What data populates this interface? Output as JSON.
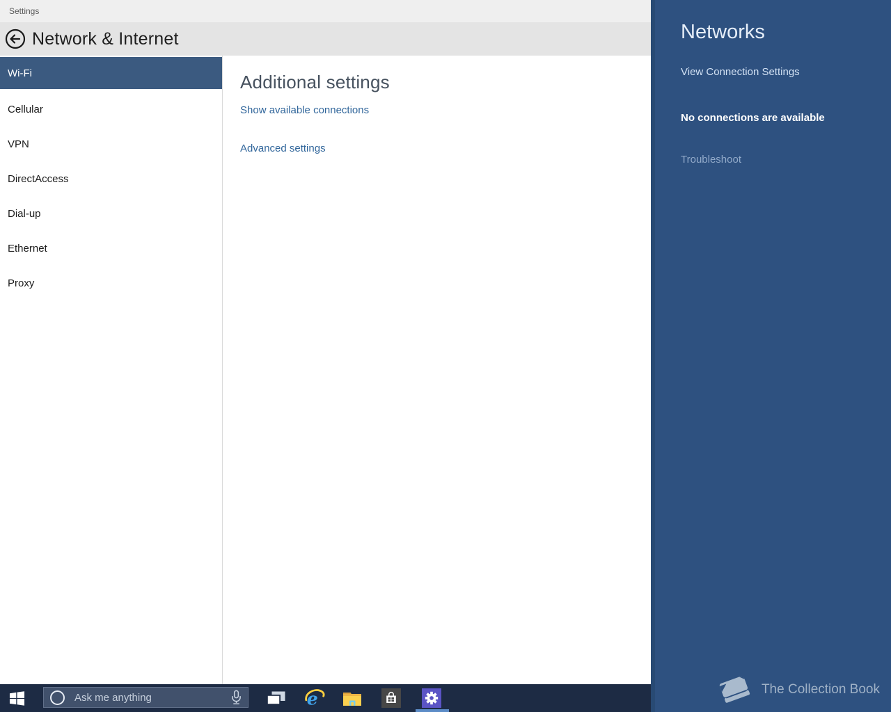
{
  "titlebar": {
    "title": "Settings"
  },
  "header": {
    "title": "Network & Internet",
    "back_icon": "back-arrow-icon"
  },
  "sidebar": {
    "items": [
      {
        "label": "Wi-Fi",
        "selected": true
      },
      {
        "label": "Cellular",
        "selected": false
      },
      {
        "label": "VPN",
        "selected": false
      },
      {
        "label": "DirectAccess",
        "selected": false
      },
      {
        "label": "Dial-up",
        "selected": false
      },
      {
        "label": "Ethernet",
        "selected": false
      },
      {
        "label": "Proxy",
        "selected": false
      }
    ]
  },
  "main": {
    "heading": "Additional settings",
    "links": [
      "Show available connections",
      "Advanced settings"
    ]
  },
  "networks_panel": {
    "title": "Networks",
    "connection_settings_link": "View Connection Settings",
    "status": "No connections are available",
    "troubleshoot": "Troubleshoot",
    "watermark": "The Collection Book",
    "watermark_icon": "book-icon"
  },
  "taskbar": {
    "search_placeholder": "Ask me anything",
    "icons": [
      "start-icon",
      "cortana-circle-icon",
      "microphone-icon",
      "task-view-icon",
      "internet-explorer-icon",
      "file-explorer-icon",
      "store-icon",
      "settings-gear-icon"
    ]
  },
  "colors": {
    "panel_blue": "#2e5180",
    "selected_item_blue": "#3b5a80",
    "taskbar_navy": "#1d2b44",
    "settings_tile_purple": "#5b54c5",
    "link_blue": "#31669b",
    "active_underline_blue": "#5c8cc7"
  }
}
